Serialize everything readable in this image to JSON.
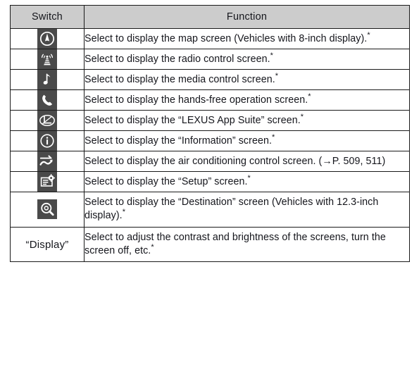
{
  "table": {
    "headers": {
      "switch": "Switch",
      "function": "Function"
    },
    "rows": [
      {
        "icon": "map-compass-icon",
        "switch_label": "",
        "function": "Select to display the map screen (Vehicles with 8-inch display).",
        "footnote": "*"
      },
      {
        "icon": "radio-tower-icon",
        "switch_label": "",
        "function": "Select to display the radio control screen.",
        "footnote": "*"
      },
      {
        "icon": "music-note-icon",
        "switch_label": "",
        "function": "Select to display the media control screen.",
        "footnote": "*"
      },
      {
        "icon": "phone-handset-icon",
        "switch_label": "",
        "function": "Select to display the hands-free operation screen.",
        "footnote": "*"
      },
      {
        "icon": "lexus-logo-icon",
        "switch_label": "",
        "function": "Select to display the “LEXUS App Suite” screen.",
        "footnote": "*"
      },
      {
        "icon": "information-icon",
        "switch_label": "",
        "function": "Select to display the “Information” screen.",
        "footnote": "*"
      },
      {
        "icon": "air-conditioning-icon",
        "switch_label": "",
        "function": "Select to display the air conditioning control screen. (→P. 509, 511)",
        "footnote": ""
      },
      {
        "icon": "setup-gear-icon",
        "switch_label": "",
        "function": "Select to display the “Setup” screen.",
        "footnote": "*"
      },
      {
        "icon": "destination-search-icon",
        "switch_label": "",
        "function": "Select to display the “Destination” screen (Vehicles with 12.3-inch display).",
        "footnote": "*"
      },
      {
        "icon": "",
        "switch_label": "“Display”",
        "function": "Select to adjust the contrast and brightness of the screens, turn the screen off, etc.",
        "footnote": "*"
      }
    ]
  },
  "colors": {
    "header_background": "#cccccc",
    "border": "#1a1a1a",
    "icon_tile_background": "#4a4a4a",
    "icon_glyph": "#ffffff",
    "text": "#15161c",
    "page_background": "#ffffff"
  }
}
